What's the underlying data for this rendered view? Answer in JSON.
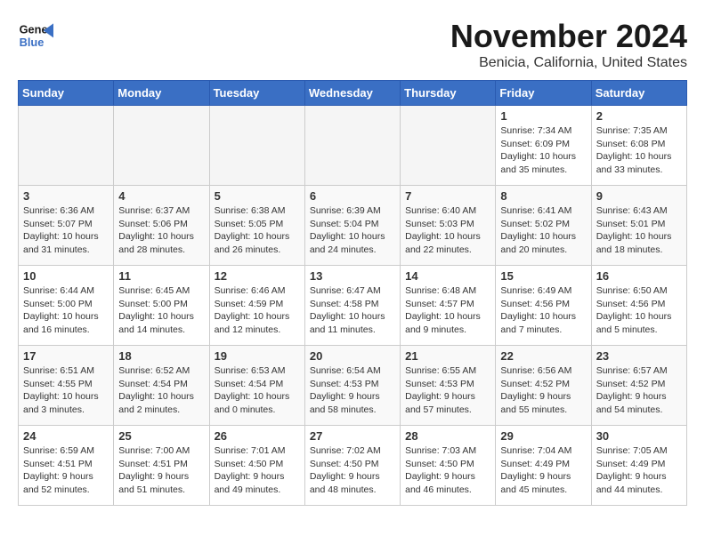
{
  "header": {
    "logo_line1": "General",
    "logo_line2": "Blue",
    "month": "November 2024",
    "location": "Benicia, California, United States"
  },
  "days_of_week": [
    "Sunday",
    "Monday",
    "Tuesday",
    "Wednesday",
    "Thursday",
    "Friday",
    "Saturday"
  ],
  "weeks": [
    {
      "days": [
        {
          "num": "",
          "info": ""
        },
        {
          "num": "",
          "info": ""
        },
        {
          "num": "",
          "info": ""
        },
        {
          "num": "",
          "info": ""
        },
        {
          "num": "",
          "info": ""
        },
        {
          "num": "1",
          "info": "Sunrise: 7:34 AM\nSunset: 6:09 PM\nDaylight: 10 hours and 35 minutes."
        },
        {
          "num": "2",
          "info": "Sunrise: 7:35 AM\nSunset: 6:08 PM\nDaylight: 10 hours and 33 minutes."
        }
      ]
    },
    {
      "days": [
        {
          "num": "3",
          "info": "Sunrise: 6:36 AM\nSunset: 5:07 PM\nDaylight: 10 hours and 31 minutes."
        },
        {
          "num": "4",
          "info": "Sunrise: 6:37 AM\nSunset: 5:06 PM\nDaylight: 10 hours and 28 minutes."
        },
        {
          "num": "5",
          "info": "Sunrise: 6:38 AM\nSunset: 5:05 PM\nDaylight: 10 hours and 26 minutes."
        },
        {
          "num": "6",
          "info": "Sunrise: 6:39 AM\nSunset: 5:04 PM\nDaylight: 10 hours and 24 minutes."
        },
        {
          "num": "7",
          "info": "Sunrise: 6:40 AM\nSunset: 5:03 PM\nDaylight: 10 hours and 22 minutes."
        },
        {
          "num": "8",
          "info": "Sunrise: 6:41 AM\nSunset: 5:02 PM\nDaylight: 10 hours and 20 minutes."
        },
        {
          "num": "9",
          "info": "Sunrise: 6:43 AM\nSunset: 5:01 PM\nDaylight: 10 hours and 18 minutes."
        }
      ]
    },
    {
      "days": [
        {
          "num": "10",
          "info": "Sunrise: 6:44 AM\nSunset: 5:00 PM\nDaylight: 10 hours and 16 minutes."
        },
        {
          "num": "11",
          "info": "Sunrise: 6:45 AM\nSunset: 5:00 PM\nDaylight: 10 hours and 14 minutes."
        },
        {
          "num": "12",
          "info": "Sunrise: 6:46 AM\nSunset: 4:59 PM\nDaylight: 10 hours and 12 minutes."
        },
        {
          "num": "13",
          "info": "Sunrise: 6:47 AM\nSunset: 4:58 PM\nDaylight: 10 hours and 11 minutes."
        },
        {
          "num": "14",
          "info": "Sunrise: 6:48 AM\nSunset: 4:57 PM\nDaylight: 10 hours and 9 minutes."
        },
        {
          "num": "15",
          "info": "Sunrise: 6:49 AM\nSunset: 4:56 PM\nDaylight: 10 hours and 7 minutes."
        },
        {
          "num": "16",
          "info": "Sunrise: 6:50 AM\nSunset: 4:56 PM\nDaylight: 10 hours and 5 minutes."
        }
      ]
    },
    {
      "days": [
        {
          "num": "17",
          "info": "Sunrise: 6:51 AM\nSunset: 4:55 PM\nDaylight: 10 hours and 3 minutes."
        },
        {
          "num": "18",
          "info": "Sunrise: 6:52 AM\nSunset: 4:54 PM\nDaylight: 10 hours and 2 minutes."
        },
        {
          "num": "19",
          "info": "Sunrise: 6:53 AM\nSunset: 4:54 PM\nDaylight: 10 hours and 0 minutes."
        },
        {
          "num": "20",
          "info": "Sunrise: 6:54 AM\nSunset: 4:53 PM\nDaylight: 9 hours and 58 minutes."
        },
        {
          "num": "21",
          "info": "Sunrise: 6:55 AM\nSunset: 4:53 PM\nDaylight: 9 hours and 57 minutes."
        },
        {
          "num": "22",
          "info": "Sunrise: 6:56 AM\nSunset: 4:52 PM\nDaylight: 9 hours and 55 minutes."
        },
        {
          "num": "23",
          "info": "Sunrise: 6:57 AM\nSunset: 4:52 PM\nDaylight: 9 hours and 54 minutes."
        }
      ]
    },
    {
      "days": [
        {
          "num": "24",
          "info": "Sunrise: 6:59 AM\nSunset: 4:51 PM\nDaylight: 9 hours and 52 minutes."
        },
        {
          "num": "25",
          "info": "Sunrise: 7:00 AM\nSunset: 4:51 PM\nDaylight: 9 hours and 51 minutes."
        },
        {
          "num": "26",
          "info": "Sunrise: 7:01 AM\nSunset: 4:50 PM\nDaylight: 9 hours and 49 minutes."
        },
        {
          "num": "27",
          "info": "Sunrise: 7:02 AM\nSunset: 4:50 PM\nDaylight: 9 hours and 48 minutes."
        },
        {
          "num": "28",
          "info": "Sunrise: 7:03 AM\nSunset: 4:50 PM\nDaylight: 9 hours and 46 minutes."
        },
        {
          "num": "29",
          "info": "Sunrise: 7:04 AM\nSunset: 4:49 PM\nDaylight: 9 hours and 45 minutes."
        },
        {
          "num": "30",
          "info": "Sunrise: 7:05 AM\nSunset: 4:49 PM\nDaylight: 9 hours and 44 minutes."
        }
      ]
    }
  ]
}
